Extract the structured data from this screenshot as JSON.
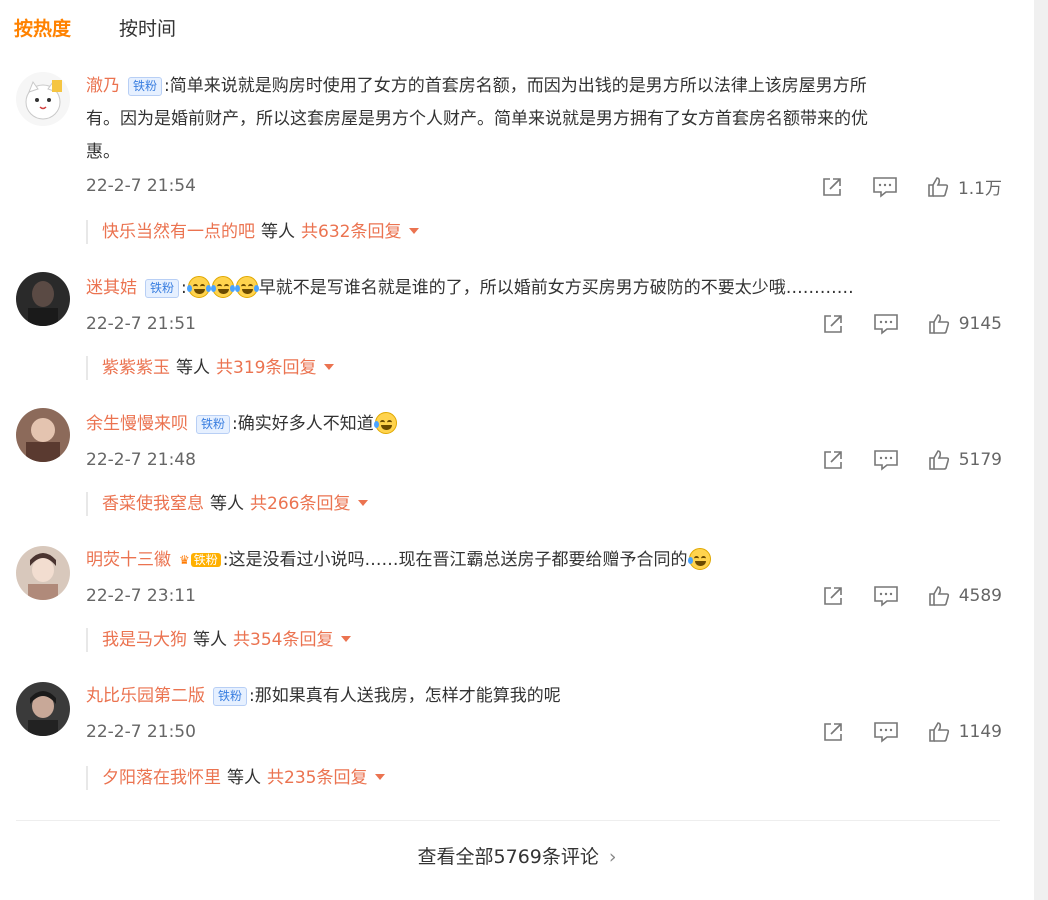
{
  "sort_tabs": {
    "hot": "按热度",
    "time": "按时间"
  },
  "icons": {
    "share": "share-icon",
    "comment": "comment-icon",
    "like": "thumbs-up-icon",
    "reply_caret": "caret-down-icon"
  },
  "colors": {
    "accent": "#ff8200",
    "username": "#eb7350",
    "badge_blue": "#3b7fe0"
  },
  "comments": [
    {
      "username": "澈乃",
      "badge": "铁粉",
      "text_line1": "简单来说就是购房时使用了女方的首套房名额，而因为出钱的是男方所以法律上该房屋男方所",
      "text_line2": "有。因为是婚前财产，所以这套房屋是男方个人财产。简单来说就是男方拥有了女方首套房名额带来的优",
      "text_line3": "惠。",
      "time": "22-2-7 21:54",
      "likes": "1.1万",
      "reply_user": "快乐当然有一点的吧",
      "reply_deng": "等人",
      "reply_total": "共632条回复"
    },
    {
      "username": "迷其姞",
      "badge": "铁粉",
      "emoji": "laugh-cry-emoji",
      "text_line1": "早就不是写谁名就是谁的了，所以婚前女方买房男方破防的不要太少哦",
      "text_tail": "…………",
      "time": "22-2-7 21:51",
      "likes": "9145",
      "reply_user": "紫紫紫玉",
      "reply_deng": "等人",
      "reply_total": "共319条回复"
    },
    {
      "username": "余生慢慢来呗",
      "badge": "铁粉",
      "emoji": "crying-emoji",
      "text_line1": "确实好多人不知道",
      "time": "22-2-7 21:48",
      "likes": "5179",
      "reply_user": "香菜使我窒息",
      "reply_deng": "等人",
      "reply_total": "共266条回复"
    },
    {
      "username": "明荧十三徽",
      "badge": "铁粉",
      "emoji": "crying-emoji",
      "text_line1": "这是没看过小说吗……现在晋江霸总送房子都要给赠予合同的",
      "time": "22-2-7 23:11",
      "likes": "4589",
      "reply_user": "我是马大狗",
      "reply_deng": "等人",
      "reply_total": "共354条回复"
    },
    {
      "username": "丸比乐园第二版",
      "badge": "铁粉",
      "text_line1": "那如果真有人送我房，怎样才能算我的呢",
      "time": "22-2-7 21:50",
      "likes": "1149",
      "reply_user": "夕阳落在我怀里",
      "reply_deng": "等人",
      "reply_total": "共235条回复"
    }
  ],
  "view_all": "查看全部5769条评论",
  "view_all_chevron": "›"
}
